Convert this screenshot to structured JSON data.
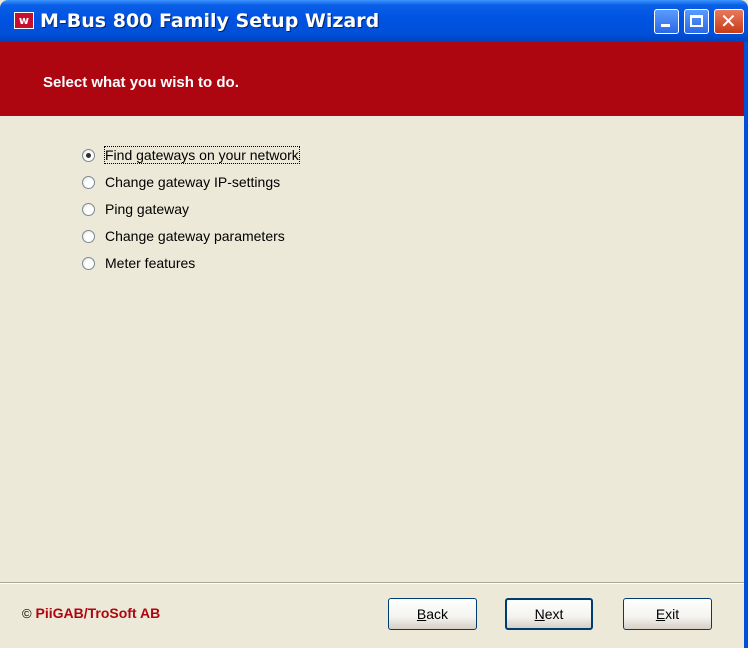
{
  "window": {
    "title": "M-Bus 800 Family Setup Wizard",
    "app_icon_letter": "w"
  },
  "header": {
    "instruction": "Select what you wish to do."
  },
  "options": [
    {
      "label": "Find gateways on your network",
      "checked": true
    },
    {
      "label": "Change gateway IP-settings",
      "checked": false
    },
    {
      "label": "Ping gateway",
      "checked": false
    },
    {
      "label": "Change gateway parameters",
      "checked": false
    },
    {
      "label": "Meter features",
      "checked": false
    }
  ],
  "footer": {
    "copyright_symbol": "©",
    "copyright_text": "PiiGAB/TroSoft AB"
  },
  "buttons": {
    "back": {
      "mnemonic": "B",
      "rest": "ack"
    },
    "next": {
      "mnemonic": "N",
      "rest": "ext"
    },
    "exit": {
      "mnemonic": "E",
      "rest": "xit"
    }
  },
  "colors": {
    "header_band": "#AD0610",
    "dialog_bg": "#ECE9D8",
    "titlebar": "#0054E3"
  }
}
